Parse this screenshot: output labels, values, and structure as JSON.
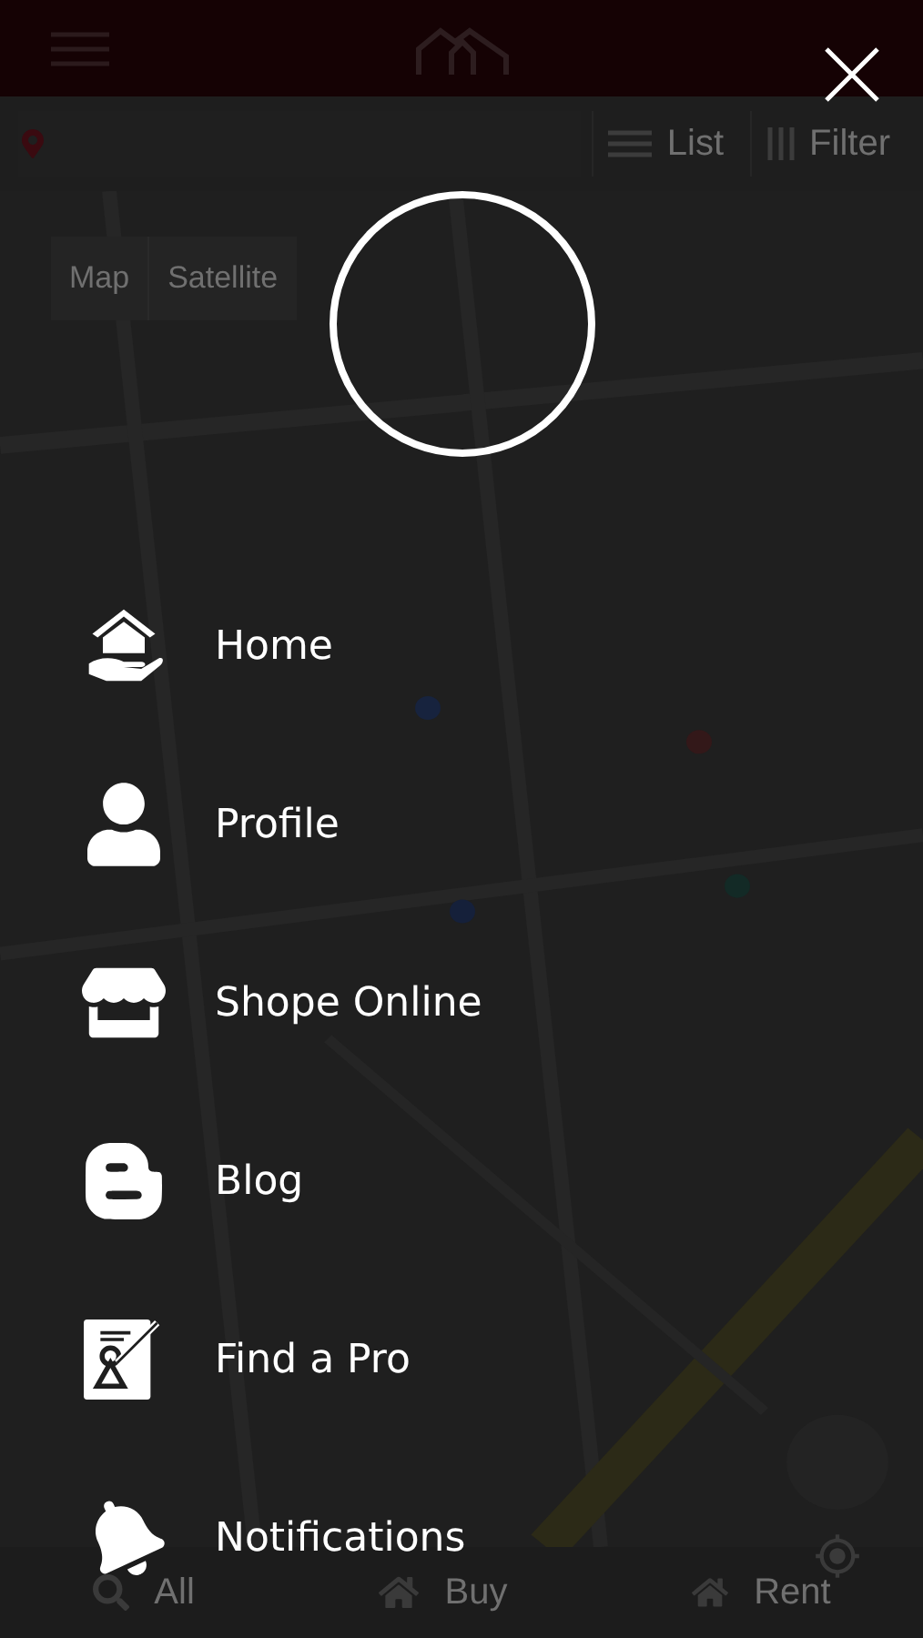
{
  "toolbar": {
    "buttons": [
      {
        "label": "List",
        "kind": "list"
      },
      {
        "label": "Filter",
        "kind": "filter"
      }
    ]
  },
  "map_type": [
    "Map",
    "Satellite"
  ],
  "bottom_tabs": [
    {
      "label": "All",
      "kind": "all"
    },
    {
      "label": "Buy",
      "kind": "buy"
    },
    {
      "label": "Rent",
      "kind": "rent"
    }
  ],
  "menu": {
    "items": [
      {
        "label": "Home",
        "kind": "home"
      },
      {
        "label": "Profile",
        "kind": "profile"
      },
      {
        "label": "Shope Online",
        "kind": "shop"
      },
      {
        "label": "Blog",
        "kind": "blog"
      },
      {
        "label": "Find a Pro",
        "kind": "pro"
      },
      {
        "label": "Notifications",
        "kind": "bell"
      }
    ]
  }
}
